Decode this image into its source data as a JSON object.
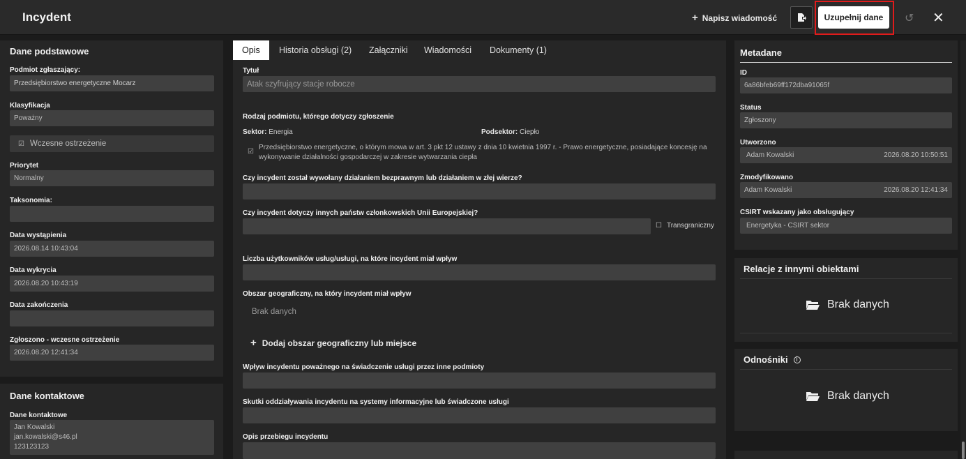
{
  "header": {
    "title": "Incydent",
    "write_message": "Napisz wiadomość",
    "fill_data": "Uzupełnij dane"
  },
  "left": {
    "basic_title": "Dane podstawowe",
    "reporter_label": "Podmiot zgłaszający:",
    "reporter_value": "Przedsiębiorstwo energetyczne Mocarz",
    "classification_label": "Klasyfikacja",
    "classification_value": "Poważny",
    "early_warning": "Wczesne ostrzeżenie",
    "priority_label": "Priorytet",
    "priority_value": "Normalny",
    "taxonomy_label": "Taksonomia:",
    "occurred_label": "Data wystąpienia",
    "occurred_value": "2026.08.14 10:43:04",
    "detected_label": "Data wykrycia",
    "detected_value": "2026.08.20 10:43:19",
    "ended_label": "Data zakończenia",
    "reported_label": "Zgłoszono - wczesne ostrzeżenie",
    "reported_value": "2026.08.20 12:41:34",
    "contact_title": "Dane kontaktowe",
    "contact_label": "Dane kontaktowe",
    "contact_lines": [
      "Jan Kowalski",
      "jan.kowalski@s46.pl",
      "123123123"
    ]
  },
  "tabs": [
    "Opis",
    "Historia obsługi (2)",
    "Załączniki",
    "Wiadomości",
    "Dokumenty (1)"
  ],
  "opis": {
    "title_label": "Tytuł",
    "title_value": "Atak szyfrujący stacje robocze",
    "entity_type_label": "Rodzaj podmiotu, którego dotyczy zgłoszenie",
    "sector_label": "Sektor:",
    "sector_value": "Energia",
    "subsector_label": "Podsektor:",
    "subsector_value": "Ciepło",
    "entity_desc": "Przedsiębiorstwo energetyczne, o którym mowa w art. 3 pkt 12 ustawy z dnia 10 kwietnia 1997 r. - Prawo energetyczne, posiadające koncesję na wykonywanie działalności gospodarczej w zakresie wytwarzania ciepła",
    "q_unlawful": "Czy incydent został wywołany działaniem bezprawnym lub działaniem w złej wierze?",
    "q_eu": "Czy incydent dotyczy innych państw członkowskich Unii Europejskiej?",
    "cross_border": "Transgraniczny",
    "users_label": "Liczba użytkowników usług/usługi, na które incydent miał wpływ",
    "geo_label": "Obszar geograficzny, na który incydent miał wpływ",
    "geo_empty": "Brak danych",
    "geo_add": "Dodaj obszar geograficzny lub miejsce",
    "impact_label": "Wpływ incydentu poważnego na świadczenie usługi przez inne podmioty",
    "effects_label": "Skutki oddziaływania incydentu na systemy informacyjne lub świadczone usługi",
    "course_label": "Opis przebiegu incydentu"
  },
  "meta": {
    "title": "Metadane",
    "id_label": "ID",
    "id_value": "6a86bfeb69ff172dba91065f",
    "status_label": "Status",
    "status_value": "Zgłoszony",
    "created_label": "Utworzono",
    "created_by": "Adam Kowalski",
    "created_at": "2026.08.20 10:50:51",
    "modified_label": "Zmodyfikowano",
    "modified_by": "Adam Kowalski",
    "modified_at": "2026.08.20 12:41:34",
    "csirt_label": "CSIRT wskazany jako obsługujący",
    "csirt_value": "Energetyka - CSIRT sektor"
  },
  "relations": {
    "title": "Relacje z innymi obiektami",
    "empty": "Brak danych"
  },
  "refs": {
    "title": "Odnośniki",
    "empty": "Brak danych"
  }
}
